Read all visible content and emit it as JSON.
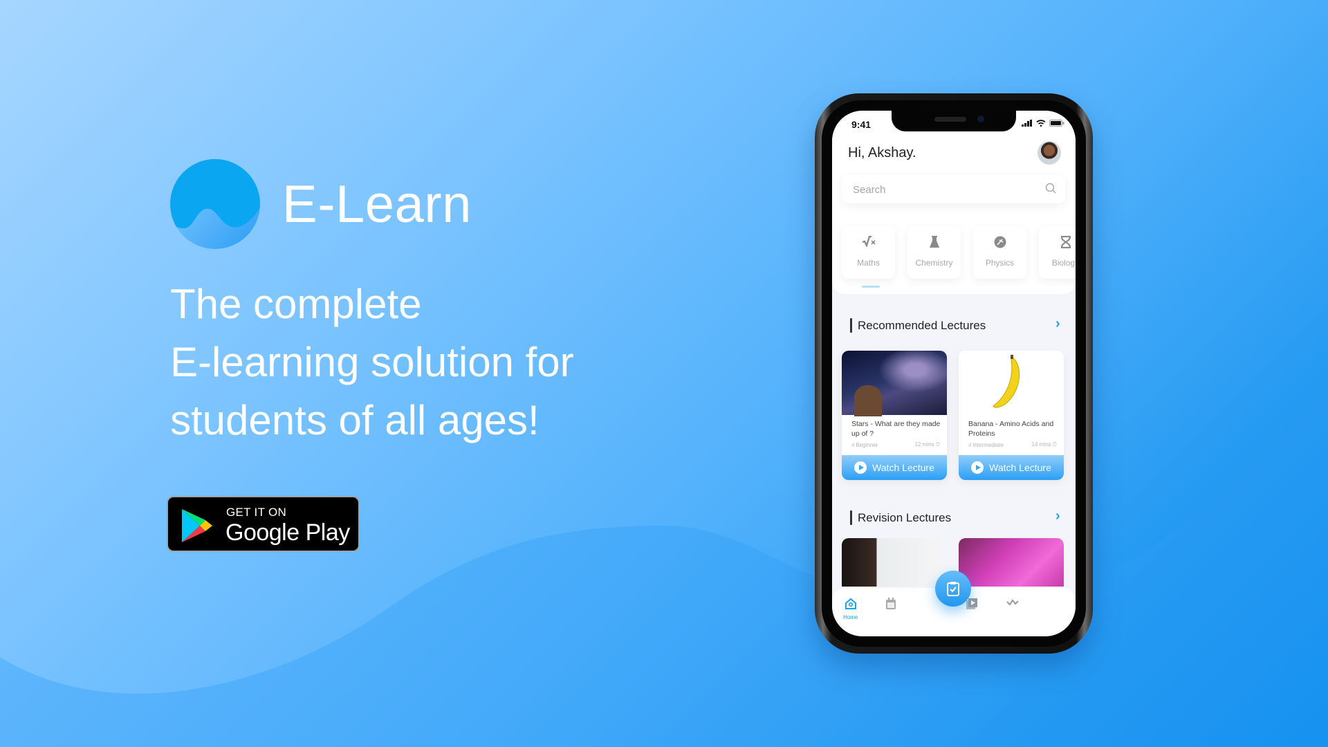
{
  "brand": {
    "name": "E-Learn",
    "colors": {
      "primary": "#1aa1f0",
      "logo_top": "#0aa6f1",
      "logo_bottom": "#4eb6ff"
    }
  },
  "headline": {
    "lines": [
      "The complete",
      "E-learning solution for",
      "students of all ages!"
    ]
  },
  "store_badge": {
    "small_text": "GET IT ON",
    "big_text": "Google Play",
    "icon": "google-play-icon"
  },
  "phone": {
    "status_bar": {
      "time": "9:41",
      "icons": [
        "signal-icon",
        "wifi-icon",
        "battery-icon"
      ]
    },
    "greeting": "Hi, Akshay.",
    "avatar": "user-avatar",
    "search": {
      "placeholder": "Search",
      "value": "",
      "icon": "search-icon"
    },
    "categories": [
      {
        "label": "Maths",
        "icon": "square-root-icon",
        "active": true
      },
      {
        "label": "Chemistry",
        "icon": "flask-icon",
        "active": false
      },
      {
        "label": "Physics",
        "icon": "atom-icon",
        "active": false
      },
      {
        "label": "Biology",
        "icon": "dna-icon",
        "active": false
      }
    ],
    "recommended": {
      "title": "Recommended Lectures",
      "arrow": "chevron-right-icon",
      "cards": [
        {
          "title": "Stars - What are they made up of ?",
          "level": "Beginner",
          "duration": "12 mins",
          "button": "Watch Lecture",
          "image": "night-sky-image"
        },
        {
          "title": "Banana - Amino Acids and Proteins",
          "level": "Intermediate",
          "duration": "14 mins",
          "button": "Watch Lecture",
          "image": "banana-image"
        }
      ]
    },
    "revision": {
      "title": "Revision Lectures",
      "arrow": "chevron-right-icon",
      "cards": [
        {
          "image": "whiteboard-drawing-image"
        },
        {
          "image": "lab-scientist-image"
        }
      ]
    },
    "tabbar": {
      "items": [
        {
          "label": "Home",
          "icon": "home-icon",
          "active": true
        },
        {
          "label": "",
          "icon": "calendar-icon",
          "active": false
        },
        {
          "label": "",
          "icon": "clipboard-check-icon",
          "active": false,
          "floating": true
        },
        {
          "label": "",
          "icon": "video-library-icon",
          "active": false
        },
        {
          "label": "",
          "icon": "activity-icon",
          "active": false
        }
      ]
    }
  }
}
